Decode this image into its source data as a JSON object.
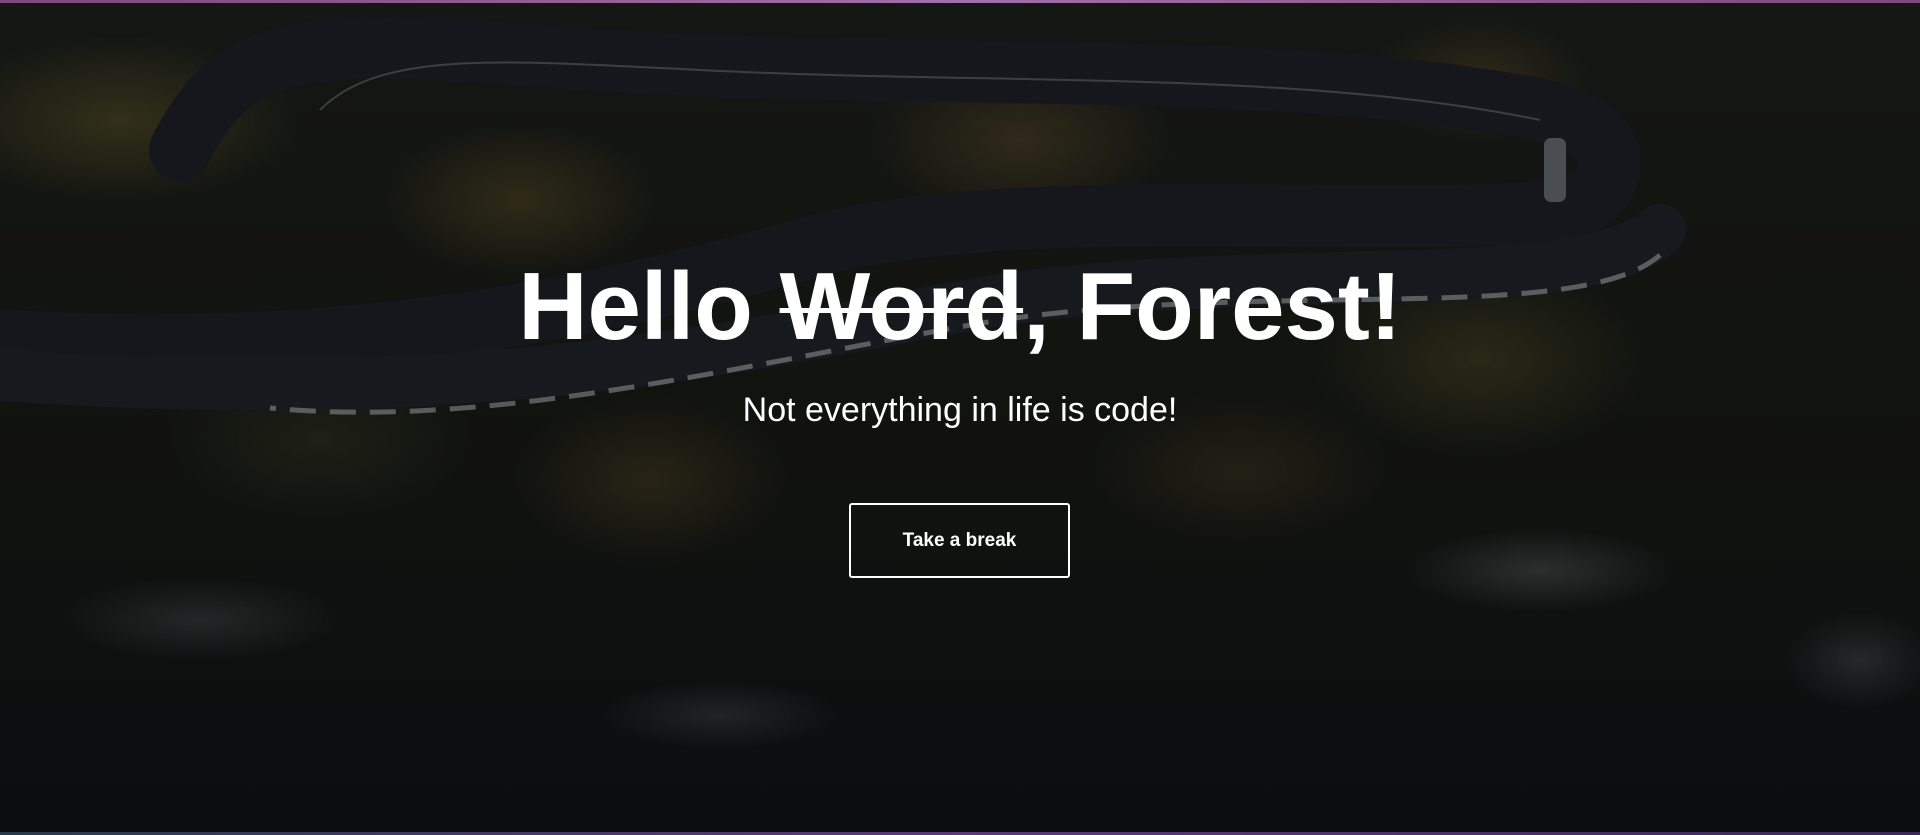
{
  "hero": {
    "title_prefix": "Hello ",
    "title_struck": "Word",
    "title_suffix": ", Forest!",
    "subtitle": "Not everything in life is code!",
    "cta_label": "Take a break"
  },
  "colors": {
    "text": "#ffffff",
    "overlay": "#0c0d12",
    "background": "#0b0c0f"
  }
}
